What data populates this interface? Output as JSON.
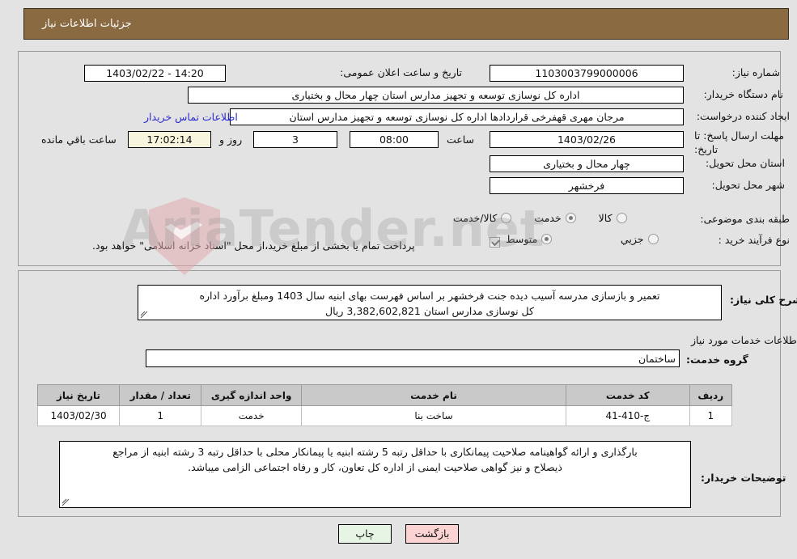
{
  "header": {
    "title": "جزئیات اطلاعات نیاز"
  },
  "watermark": {
    "text": "AriaTender.net"
  },
  "top_panel": {
    "fields": {
      "need_number": {
        "label": "شماره نیاز:",
        "value": "1103003799000006"
      },
      "public_announce_datetime": {
        "label": "تاریخ و ساعت اعلان عمومی:",
        "value": "1403/02/22 - 14:20"
      },
      "buyer_org": {
        "label": "نام دستگاه خریدار:",
        "value": "اداره کل نوسازی  توسعه و تجهیز مدارس استان چهار محال و بختیاری"
      },
      "request_creator": {
        "label": "ایجاد کننده درخواست:",
        "value": "مرجان مهری قهفرخی قراردادها اداره کل نوسازی  توسعه و تجهیز مدارس استان"
      },
      "buyer_contact_link": "اطلاعات تماس خریدار",
      "response_deadline": {
        "label": "مهلت ارسال پاسخ: تا تاریخ:",
        "value": "1403/02/26"
      },
      "deadline_time": {
        "label": "ساعت",
        "value": "08:00"
      },
      "remaining_days": {
        "value": "3",
        "suffix": "روز و"
      },
      "remaining_time": {
        "value": "17:02:14",
        "suffix": "ساعت باقي مانده"
      },
      "delivery_province": {
        "label": "استان محل تحویل:",
        "value": "چهار محال و بختیاری"
      },
      "delivery_city": {
        "label": "شهر محل تحویل:",
        "value": "فرخشهر"
      },
      "subject_category": {
        "label": "طبقه بندی موضوعی:"
      },
      "purchase_process": {
        "label": "نوع فرآیند خرید :"
      }
    },
    "category_options": [
      {
        "label": "کالا",
        "selected": false
      },
      {
        "label": "خدمت",
        "selected": true
      },
      {
        "label": "کالا/خدمت",
        "selected": false
      }
    ],
    "process_options": [
      {
        "label": "جزیي",
        "selected": false
      },
      {
        "label": "متوسط",
        "selected": true
      }
    ],
    "treasury_checkbox": {
      "checked": true,
      "label": "پرداخت تمام یا بخشی از مبلغ خرید،از محل \"اسناد خزانه اسلامی\" خواهد بود."
    }
  },
  "bottom_panel": {
    "overview": {
      "label": "شرح کلی نیاز:",
      "line1": "تعمیر و بازسازی مدرسه آسیب دیده جنت فرخشهر بر اساس فهرست بهای ابنیه سال 1403 ومبلغ برآورد اداره",
      "line2": "کل نوسازی مدارس استان 3,382,602,821 ریال"
    },
    "services_heading": "اطلاعات خدمات مورد نیاز",
    "service_group": {
      "label": "گروه خدمت:",
      "value": "ساختمان"
    },
    "table": {
      "columns": [
        "ردیف",
        "کد خدمت",
        "نام خدمت",
        "واحد اندازه گیری",
        "تعداد / مقدار",
        "تاریخ نیاز"
      ],
      "rows": [
        [
          "1",
          "ج-410-41",
          "ساخت بنا",
          "خدمت",
          "1",
          "1403/02/30"
        ]
      ]
    },
    "buyer_notes": {
      "label": "توضیحات خریدار:",
      "line1": "بارگذاری و ارائه گواهینامه صلاحیت پیمانکاری با حداقل رتبه 5 رشته ابنیه یا پیمانکار محلی با حداقل رتبه 3 رشته ابنیه از مراجع",
      "line2": "ذیصلاح و نیز گواهی صلاحیت ایمنی از اداره کل تعاون، کار و رفاه اجتماعی الزامی میباشد."
    }
  },
  "footer": {
    "print_label": "چاپ",
    "back_label": "بازگشت"
  },
  "colors": {
    "header_bg": "#8a6a41",
    "page_bg": "#e3e3e3",
    "link": "#2a2ad0",
    "table_header_bg": "#c9c9c9",
    "timer_bg": "#f7f5dc",
    "print_btn_bg": "#e7f6e4",
    "back_btn_bg": "#fbd3d3"
  }
}
